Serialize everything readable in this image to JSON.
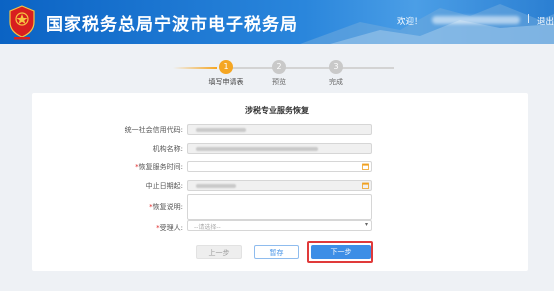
{
  "header": {
    "title": "国家税务总局宁波市电子税务局",
    "welcome": "欢迎！",
    "separator": "|",
    "logout": "退出"
  },
  "steps": [
    {
      "number": "1",
      "label": "填写申请表",
      "active": true
    },
    {
      "number": "2",
      "label": "预览",
      "active": false
    },
    {
      "number": "3",
      "label": "完成",
      "active": false
    }
  ],
  "form": {
    "title": "涉税专业服务恢复",
    "fields": [
      {
        "label": "统一社会信用代码:",
        "required": false
      },
      {
        "label": "机构名称:",
        "required": false
      },
      {
        "label": "恢复服务时间:",
        "required": true
      },
      {
        "label": "中止日期起:",
        "required": false
      },
      {
        "label": "恢复说明:",
        "required": true
      },
      {
        "label": "受理人:",
        "required": true
      }
    ],
    "select_placeholder": "--请选择--"
  },
  "buttons": {
    "prev": "上一步",
    "save": "暂存",
    "next": "下一步"
  },
  "colors": {
    "header_blue": "#0b63c4",
    "active_step": "#f5a623",
    "primary_button": "#3d8ee6",
    "highlight": "#e03a3a"
  }
}
